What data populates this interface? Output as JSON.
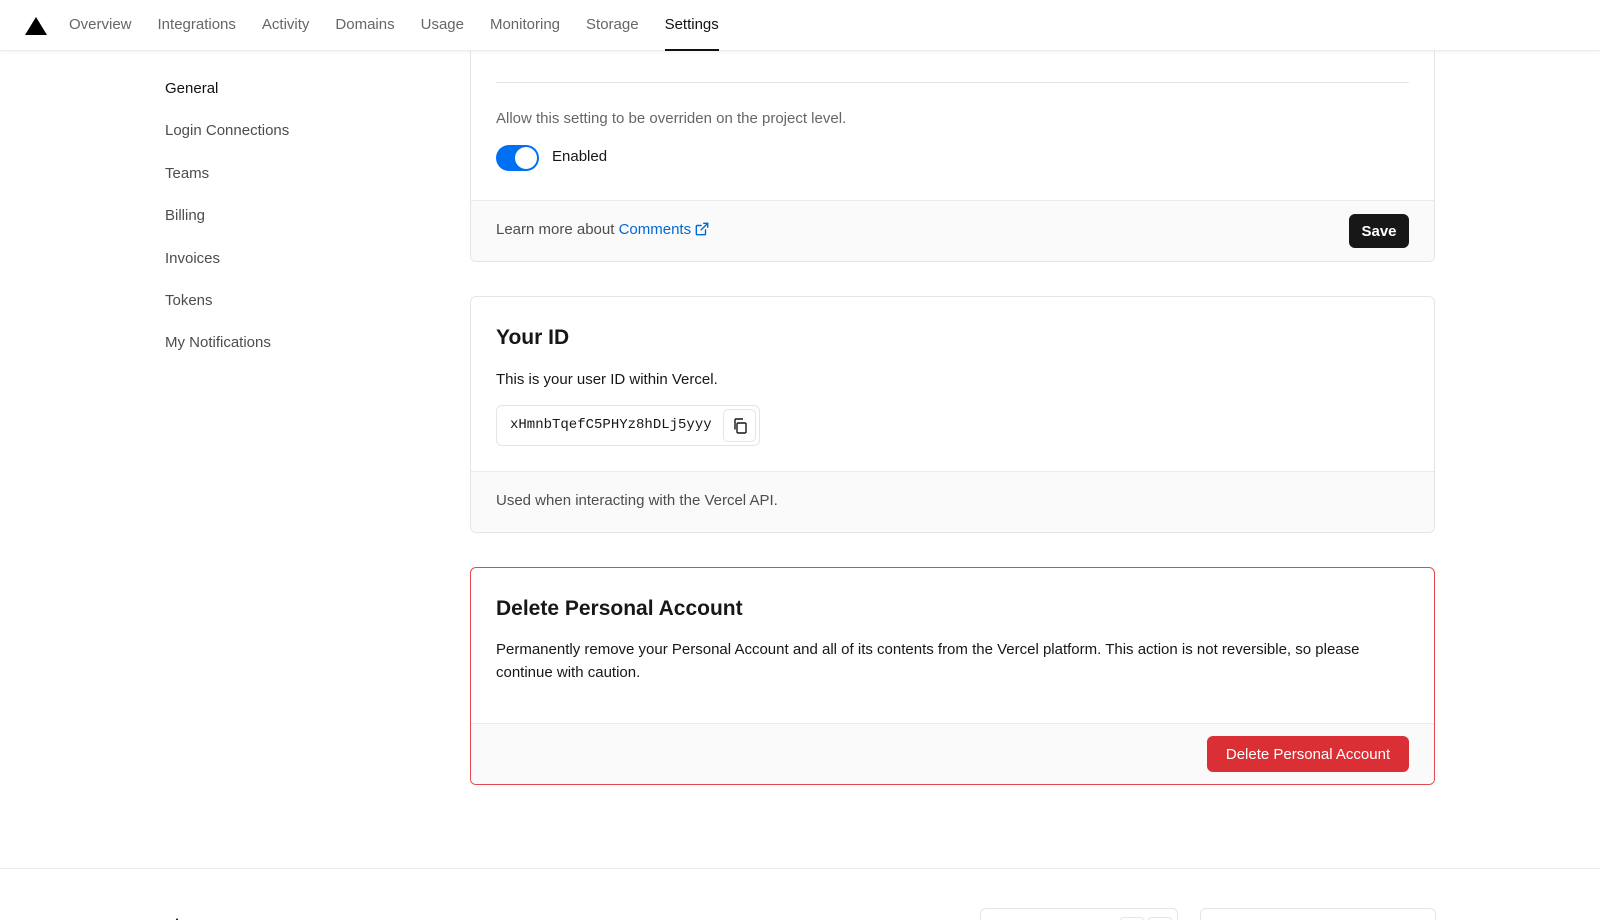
{
  "nav": {
    "tabs": [
      "Overview",
      "Integrations",
      "Activity",
      "Domains",
      "Usage",
      "Monitoring",
      "Storage",
      "Settings"
    ],
    "active_tab": "Settings"
  },
  "sidebar": {
    "items": [
      "General",
      "Login Connections",
      "Teams",
      "Billing",
      "Invoices",
      "Tokens",
      "My Notifications"
    ],
    "active_item": "General"
  },
  "comments_card": {
    "allow_text": "Allow this setting to be overriden on the project level.",
    "toggle_state": true,
    "toggle_label": "Enabled",
    "learn_prefix": "Learn more about ",
    "learn_link": "Comments",
    "save_label": "Save"
  },
  "id_card": {
    "title": "Your ID",
    "description": "This is your user ID within Vercel.",
    "user_id": "xHmnbTqefC5PHYz8hDLj5yyy",
    "footer_note": "Used when interacting with the Vercel API."
  },
  "danger_card": {
    "title": "Delete Personal Account",
    "description": "Permanently remove your Personal Account and all of its contents from the Vercel platform. This action is not reversible, so please continue with caution.",
    "button_label": "Delete Personal Account"
  },
  "colors": {
    "accent": "#0070f3",
    "danger": "#da2f35",
    "dark_button": "#171717"
  }
}
